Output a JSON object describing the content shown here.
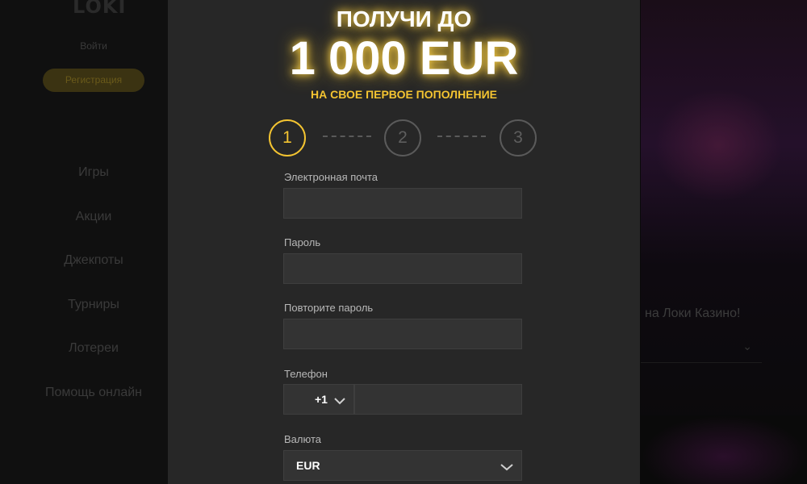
{
  "background": {
    "logo": "LOKI",
    "login": "Войти",
    "register": "Регистрация",
    "nav": [
      "Игры",
      "Акции",
      "Джекпоты",
      "Турниры",
      "Лотереи",
      "Помощь онлайн"
    ],
    "right_text": "на Локи Казино!"
  },
  "modal": {
    "promo": {
      "line1": "ПОЛУЧИ ДО",
      "amount": "1 000 EUR",
      "line3": "НА СВОЕ ПЕРВОЕ ПОПОЛНЕНИЕ"
    },
    "steps": [
      "1",
      "2",
      "3"
    ],
    "active_step": 1,
    "fields": {
      "email_label": "Электронная почта",
      "email_value": "",
      "password_label": "Пароль",
      "password_value": "",
      "repeat_password_label": "Повторите пароль",
      "repeat_password_value": "",
      "phone_label": "Телефон",
      "phone_code": "+1",
      "phone_value": "",
      "currency_label": "Валюта",
      "currency_value": "EUR"
    }
  },
  "colors": {
    "accent": "#f4c431",
    "modal_bg": "#272727",
    "input_bg": "#333333"
  }
}
